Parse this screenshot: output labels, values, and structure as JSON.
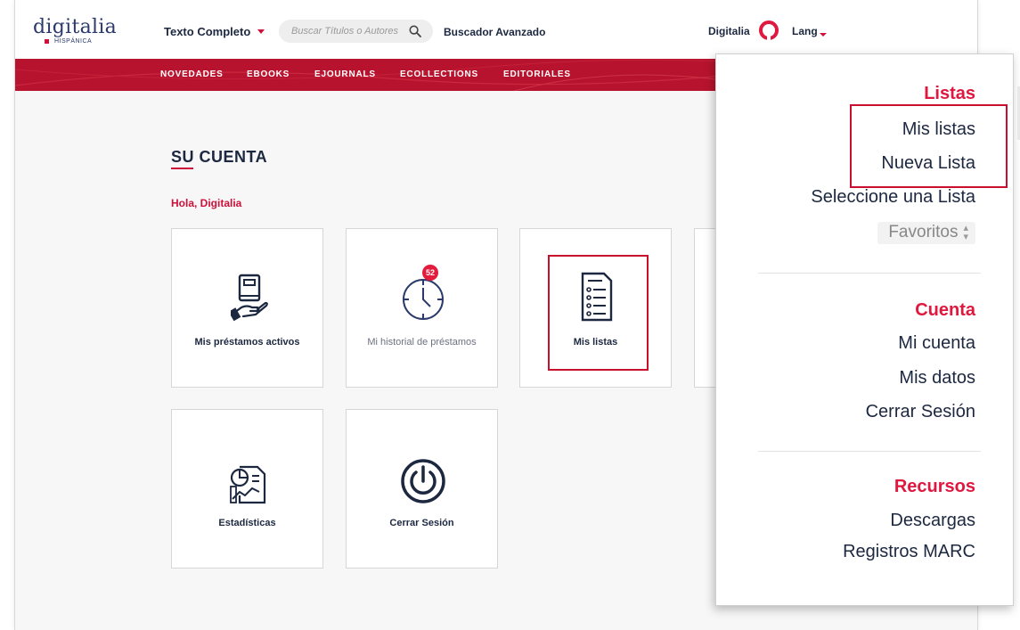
{
  "header": {
    "logo_text": "digitalia",
    "logo_sub": "HISPÁNICA",
    "search_type": "Texto Completo",
    "search_placeholder": "Buscar Títulos o Autores",
    "advanced_search": "Buscador Avanzado",
    "user_name": "Digitalia",
    "lang_label": "Lang"
  },
  "nav": {
    "items": [
      "NOVEDADES",
      "EBOOKS",
      "EJOURNALS",
      "ECOLLECTIONS",
      "EDITORIALES"
    ]
  },
  "account": {
    "title": "SU CUENTA",
    "greeting": "Hola, Digitalia",
    "tiles": [
      {
        "label": "Mis préstamos activos",
        "icon": "book-hand-icon"
      },
      {
        "label": "Mi historial de préstamos",
        "icon": "clock-history-icon",
        "badge": "52"
      },
      {
        "label": "Mis listas",
        "icon": "list-document-icon"
      },
      {
        "label": "Estadísticas",
        "icon": "statistics-report-icon"
      },
      {
        "label": "Cerrar Sesión",
        "icon": "power-icon"
      }
    ]
  },
  "dropdown": {
    "listas_header": "Listas",
    "mis_listas": "Mis listas",
    "nueva_lista": "Nueva Lista",
    "seleccione": "Seleccione una Lista",
    "select_value": "Favoritos",
    "cuenta_header": "Cuenta",
    "mi_cuenta": "Mi cuenta",
    "mis_datos": "Mis datos",
    "cerrar_sesion": "Cerrar Sesión",
    "recursos_header": "Recursos",
    "descargas": "Descargas",
    "registros_marc": "Registros MARC"
  },
  "colors": {
    "brand_red": "#b8132e",
    "accent_red": "#e0173f",
    "navy": "#1c2740"
  }
}
